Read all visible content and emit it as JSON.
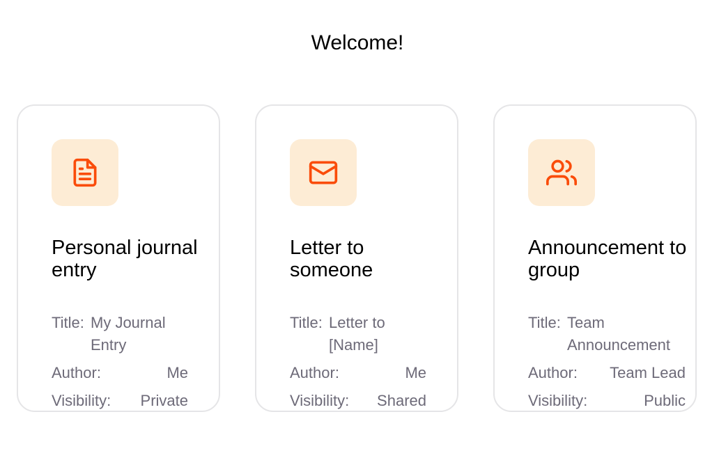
{
  "page": {
    "heading": "Welcome!"
  },
  "colors": {
    "accent": "#fa4c0a",
    "icon_bg": "#fdecd5",
    "muted_text": "#6d6a78",
    "card_border": "#e5e5e7"
  },
  "cards": [
    {
      "icon": "document-icon",
      "title": "Personal journal entry",
      "title_label": "Title:",
      "title_value": "My Journal Entry",
      "author_label": "Author:",
      "author_value": "Me",
      "visibility_label": "Visibility:",
      "visibility_value": "Private"
    },
    {
      "icon": "mail-icon",
      "title": "Letter to someone",
      "title_label": "Title:",
      "title_value": "Letter to [Name]",
      "author_label": "Author:",
      "author_value": "Me",
      "visibility_label": "Visibility:",
      "visibility_value": "Shared"
    },
    {
      "icon": "users-icon",
      "title": "Announcement to group",
      "title_label": "Title:",
      "title_value": "Team Announcement",
      "author_label": "Author:",
      "author_value": "Team Lead",
      "visibility_label": "Visibility:",
      "visibility_value": "Public"
    }
  ]
}
